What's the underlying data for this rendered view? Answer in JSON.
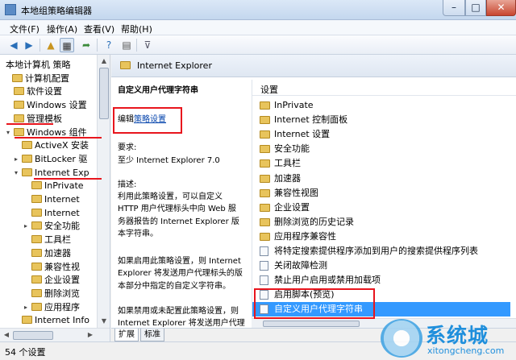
{
  "window": {
    "title": "本地组策略编辑器",
    "min": "–",
    "max": "□",
    "close": "✕"
  },
  "menus": [
    "文件(F)",
    "操作(A)",
    "查看(V)",
    "帮助(H)"
  ],
  "toolbar": [
    "back-icon",
    "forward-icon",
    "up-icon",
    "show-tree-icon",
    "export-icon",
    "help-icon",
    "properties-icon",
    "filter-icon"
  ],
  "tree": [
    {
      "label": "本地计算机 策略",
      "level": 0,
      "folder": false,
      "arrow": ""
    },
    {
      "label": "计算机配置",
      "level": 1,
      "folder": true,
      "arrow": ""
    },
    {
      "label": "软件设置",
      "level": 2,
      "folder": true,
      "arrow": ""
    },
    {
      "label": "Windows 设置",
      "level": 2,
      "folder": true,
      "arrow": ""
    },
    {
      "label": "管理模板",
      "level": 2,
      "folder": true,
      "arrow": ""
    },
    {
      "label": "Windows 组件",
      "level": 3,
      "folder": true,
      "arrow": "▾"
    },
    {
      "label": "ActiveX 安装",
      "level": 4,
      "folder": true,
      "arrow": ""
    },
    {
      "label": "BitLocker 驱",
      "level": 4,
      "folder": true,
      "arrow": "▸"
    },
    {
      "label": "Internet Exp",
      "level": 4,
      "folder": true,
      "arrow": "▾"
    },
    {
      "label": "InPrivate",
      "level": 5,
      "folder": true,
      "arrow": ""
    },
    {
      "label": "Internet",
      "level": 5,
      "folder": true,
      "arrow": ""
    },
    {
      "label": "Internet",
      "level": 5,
      "folder": true,
      "arrow": ""
    },
    {
      "label": "安全功能",
      "level": 5,
      "folder": true,
      "arrow": "▸"
    },
    {
      "label": "工具栏",
      "level": 5,
      "folder": true,
      "arrow": ""
    },
    {
      "label": "加速器",
      "level": 5,
      "folder": true,
      "arrow": ""
    },
    {
      "label": "兼容性视",
      "level": 5,
      "folder": true,
      "arrow": ""
    },
    {
      "label": "企业设置",
      "level": 5,
      "folder": true,
      "arrow": ""
    },
    {
      "label": "删除浏览",
      "level": 5,
      "folder": true,
      "arrow": ""
    },
    {
      "label": "应用程序",
      "level": 5,
      "folder": true,
      "arrow": "▸"
    },
    {
      "label": "Internet Info",
      "level": 4,
      "folder": true,
      "arrow": ""
    }
  ],
  "header": {
    "title": "Internet Explorer"
  },
  "description": {
    "policy_title": "自定义用户代理字符串",
    "edit_prefix": "编辑",
    "edit_link": "策略设置",
    "req_label": "要求:",
    "req_value": "至少 Internet Explorer 7.0",
    "desc_label": "描述:",
    "desc_lines": [
      "利用此策略设置，可以自定义",
      "HTTP 用户代理标头中向 Web 服",
      "务器报告的 Internet Explorer 版",
      "本字符串。"
    ],
    "p2_lines": [
      "如果启用此策略设置，则 Internet",
      "Explorer 将发送用户代理标头的版",
      "本部分中指定的自定义字符串。"
    ],
    "p3_lines": [
      "如果禁用或未配置此策略设置，则",
      "Internet Explorer 将发送用户代理"
    ]
  },
  "settings": {
    "header": "设置",
    "items": [
      {
        "label": "InPrivate",
        "type": "folder"
      },
      {
        "label": "Internet 控制面板",
        "type": "folder"
      },
      {
        "label": "Internet 设置",
        "type": "folder"
      },
      {
        "label": "安全功能",
        "type": "folder"
      },
      {
        "label": "工具栏",
        "type": "folder"
      },
      {
        "label": "加速器",
        "type": "folder"
      },
      {
        "label": "兼容性视图",
        "type": "folder"
      },
      {
        "label": "企业设置",
        "type": "folder"
      },
      {
        "label": "删除浏览的历史记录",
        "type": "folder"
      },
      {
        "label": "应用程序兼容性",
        "type": "folder"
      },
      {
        "label": "将特定搜索提供程序添加到用户的搜索提供程序列表",
        "type": "policy"
      },
      {
        "label": "关闭故障检测",
        "type": "policy"
      },
      {
        "label": "禁止用户启用或禁用加载项",
        "type": "policy"
      },
      {
        "label": "启用脚本(预览)",
        "type": "policy"
      },
      {
        "label": "自定义用户代理字符串",
        "type": "policy",
        "selected": true
      }
    ]
  },
  "tabs": [
    "扩展",
    "标准"
  ],
  "status": "54 个设置",
  "watermark": {
    "cn": "系统城",
    "en": "xitongcheng.com"
  }
}
